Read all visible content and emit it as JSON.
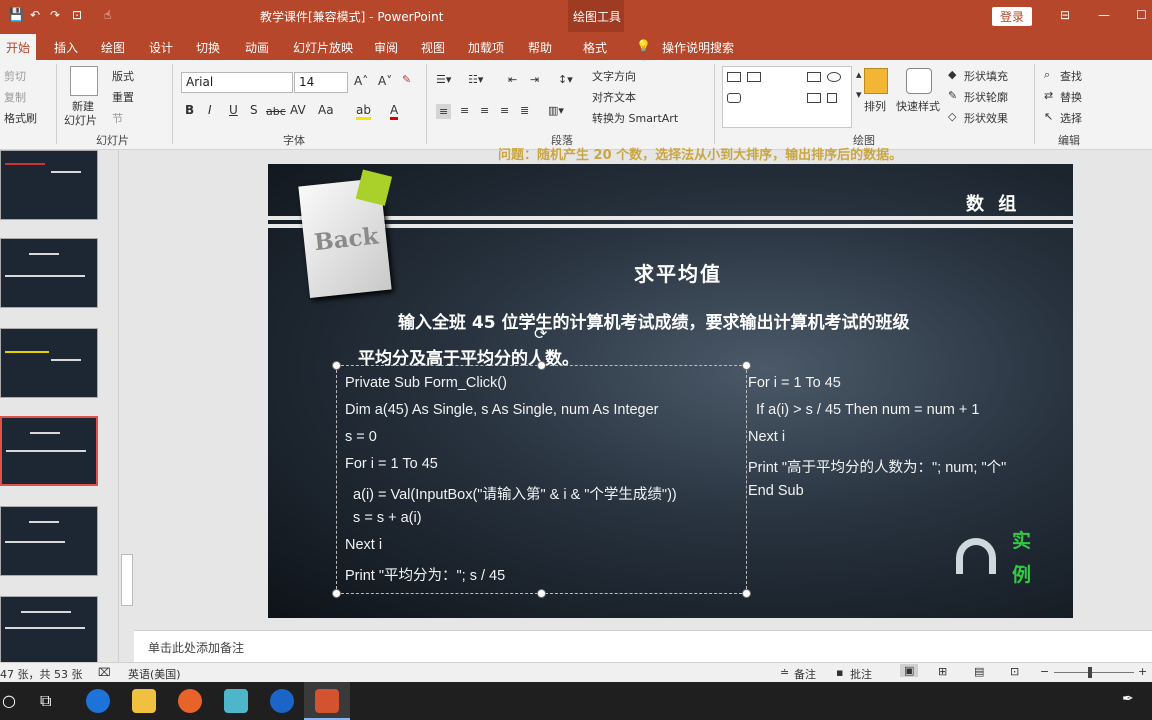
{
  "window": {
    "title": "教学课件[兼容模式] - PowerPoint",
    "context_tab": "绘图工具",
    "login": "登录"
  },
  "tabs": [
    "开始",
    "插入",
    "绘图",
    "设计",
    "切换",
    "动画",
    "幻灯片放映",
    "审阅",
    "视图",
    "加载项",
    "帮助",
    "格式"
  ],
  "search_tab": "操作说明搜索",
  "ribbon": {
    "clipboard": {
      "cut": "剪切",
      "copy": "复制",
      "format_painter": "格式刷"
    },
    "slides": {
      "new_slide": "新建",
      "new_slide2": "幻灯片",
      "layout": "版式",
      "reset": "重置",
      "section": "节",
      "group": "幻灯片"
    },
    "font": {
      "name": "Arial",
      "size": "14",
      "group": "字体"
    },
    "paragraph": {
      "text_direction": "文字方向",
      "align_text": "对齐文本",
      "smartart": "转换为 SmartArt",
      "group": "段落"
    },
    "drawing": {
      "arrange": "排列",
      "quick_styles": "快速样式",
      "shape_fill": "形状填充",
      "shape_outline": "形状轮廓",
      "shape_effects": "形状效果",
      "group": "绘图"
    },
    "editing": {
      "find": "查找",
      "replace": "替换",
      "select": "选择",
      "group": "编辑"
    }
  },
  "slide": {
    "top_banner": "问题：随机产生 20 个数，选择法从小到大排序，输出排序后的数据。",
    "back_label": "Back",
    "header": "数 组",
    "title": "求平均值",
    "problem_line1": "输入全班 45 位学生的计算机考试成绩，要求输出计算机考试的班级",
    "problem_line2": "平均分及高于平均分的人数。",
    "code_left": [
      "Private Sub Form_Click()",
      "Dim a(45) As Single, s As Single, num As Integer",
      "s = 0",
      "For i = 1 To 45",
      "  a(i) = Val(InputBox(\"请输入第\" & i & \"个学生成绩\"))",
      "  s = s + a(i)",
      "Next i",
      "Print \"平均分为：\"; s / 45"
    ],
    "code_right": [
      "For i = 1 To 45",
      "  If a(i) > s / 45 Then num = num + 1",
      "Next i",
      "Print \"高于平均分的人数为：\"; num; \"个\"",
      "End Sub"
    ],
    "example_label1": "实",
    "example_label2": "例"
  },
  "notes_placeholder": "单击此处添加备注",
  "status": {
    "slide_count": "47 张，共 53 张",
    "language": "英语(美国)",
    "notes": "备注",
    "comments": "批注"
  },
  "colors": {
    "accent": "#b7472a",
    "example_green": "#2ecc40"
  }
}
